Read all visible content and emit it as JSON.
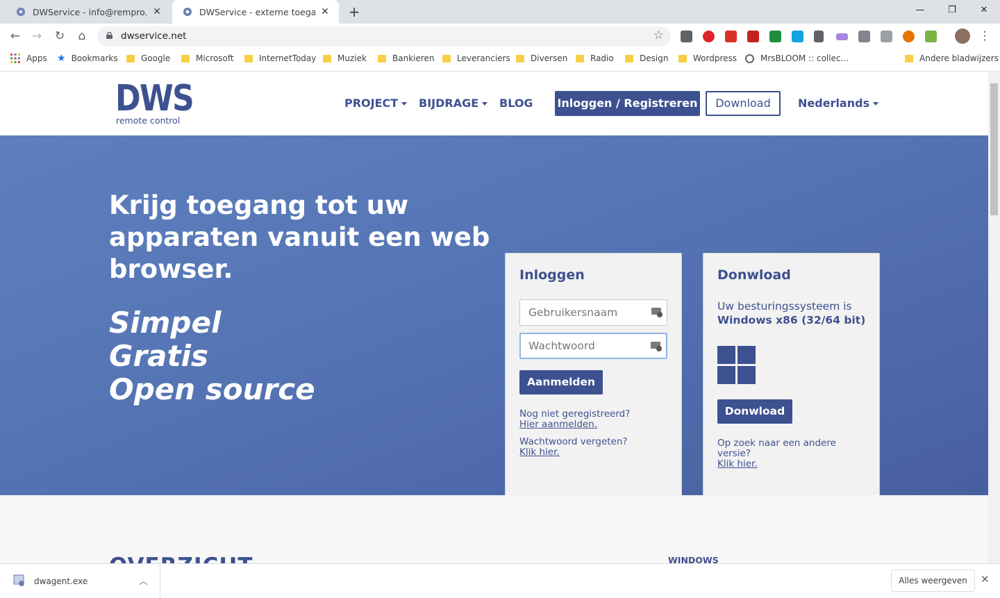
{
  "browser": {
    "tabs": [
      {
        "title": "DWService - info@rempro.nl",
        "active": false
      },
      {
        "title": "DWService - externe toegang, ex",
        "active": true
      }
    ],
    "new_tab": "+",
    "window_controls": {
      "minimize": "—",
      "maximize": "❐",
      "close": "✕"
    },
    "url": "dwservice.net",
    "bookmarks": [
      {
        "label": "Apps",
        "icon": "apps-grid-icon"
      },
      {
        "label": "Bookmarks",
        "icon": "star-icon"
      },
      {
        "label": "Google",
        "icon": "folder-icon"
      },
      {
        "label": "Microsoft",
        "icon": "folder-icon"
      },
      {
        "label": "InternetToday",
        "icon": "folder-icon"
      },
      {
        "label": "Muziek",
        "icon": "folder-icon"
      },
      {
        "label": "Bankieren",
        "icon": "folder-icon"
      },
      {
        "label": "Leveranciers",
        "icon": "folder-icon"
      },
      {
        "label": "Diversen",
        "icon": "folder-icon"
      },
      {
        "label": "Radio",
        "icon": "folder-icon"
      },
      {
        "label": "Design",
        "icon": "folder-icon"
      },
      {
        "label": "Wordpress",
        "icon": "folder-icon"
      },
      {
        "label": "MrsBLOOM :: collec...",
        "icon": "globe-icon"
      }
    ],
    "other_bookmarks": "Andere bladwijzers"
  },
  "site": {
    "logo": {
      "text": "DWS",
      "subtitle": "remote control"
    },
    "menu": {
      "project": "PROJECT",
      "bijdrage": "BIJDRAGE",
      "blog": "BLOG",
      "login": "Inloggen / Registreren",
      "download": "Download",
      "language": "Nederlands"
    },
    "hero": {
      "title": "Krijg toegang tot uw apparaten vanuit een web browser.",
      "slogan": [
        "Simpel",
        "Gratis",
        "Open source"
      ]
    },
    "login_card": {
      "title": "Inloggen",
      "username_placeholder": "Gebruikersnaam",
      "password_placeholder": "Wachtwoord",
      "submit": "Aanmelden",
      "not_registered": "Nog niet geregistreerd?",
      "register_link": "Hier aanmelden.",
      "forgot": "Wachtwoord vergeten?",
      "forgot_link": "Klik hier."
    },
    "download_card": {
      "title": "Donwload",
      "os_text": "Uw besturingssysteem is",
      "os_name": "Windows x86 (32/64 bit)",
      "button": "Donwload",
      "other_version": "Op zoek naar een andere versie?",
      "other_link": "Klik hier."
    },
    "section2": {
      "title": "OVERZICHT",
      "windows_label": "WINDOWS"
    }
  },
  "downloads_bar": {
    "file": "dwagent.exe",
    "show_all": "Alles weergeven"
  },
  "colors": {
    "brand": "#3d5190",
    "hero": "#5574b4"
  }
}
